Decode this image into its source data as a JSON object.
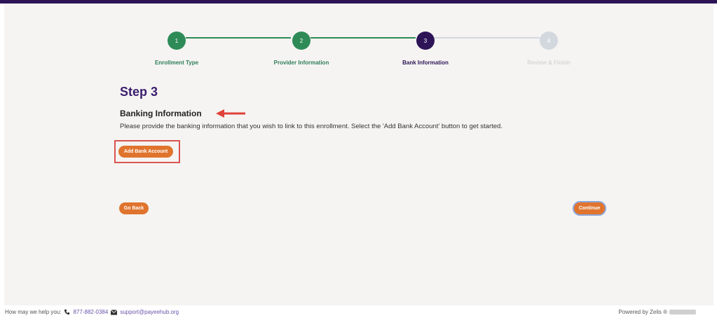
{
  "stepper": {
    "steps": [
      {
        "number": "1",
        "label": "Enrollment Type",
        "state": "done"
      },
      {
        "number": "2",
        "label": "Provider Information",
        "state": "done"
      },
      {
        "number": "3",
        "label": "Bank Information",
        "state": "current"
      },
      {
        "number": "4",
        "label": "Review & Finish",
        "state": "future"
      }
    ],
    "colors": {
      "done": "#2e8b57",
      "current": "#2d1457",
      "future": "#d3d8df"
    }
  },
  "content": {
    "step_title": "Step 3",
    "section_title": "Banking Information",
    "description": "Please provide the banking information that you wish to link to this enrollment. Select the 'Add Bank Account' button to get started."
  },
  "buttons": {
    "add_bank_account": "Add Bank Account",
    "go_back": "Go Back",
    "continue": "Continue"
  },
  "footer": {
    "help_text": "How may we help you:",
    "phone": "877-882-0384",
    "email": "support@payeehub.org",
    "powered_by": "Powered by Zelis ®"
  }
}
